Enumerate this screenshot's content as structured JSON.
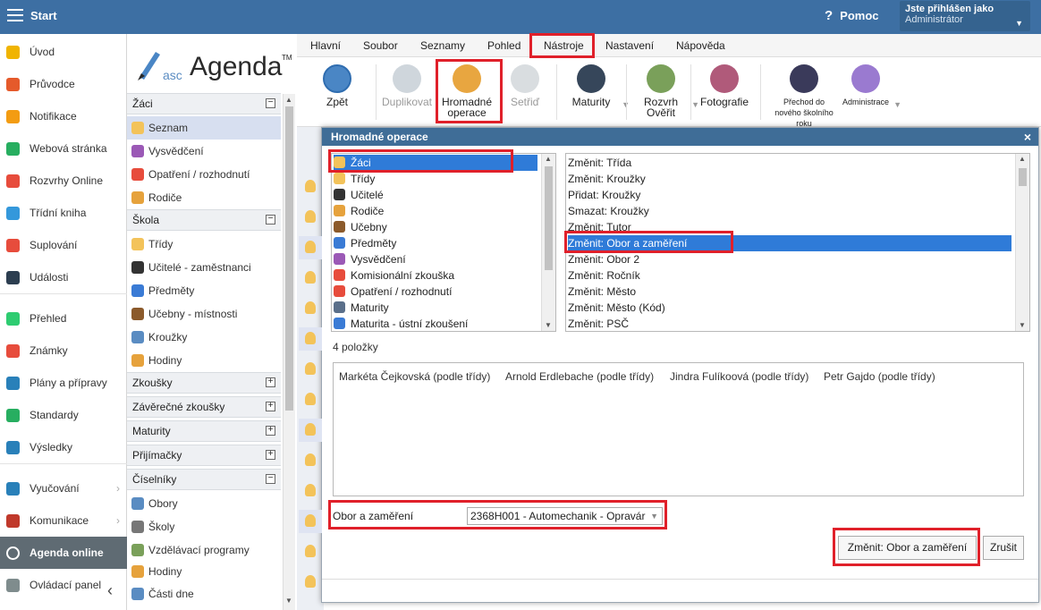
{
  "topbar": {
    "start_label": "Start",
    "help_label": "Pomoc",
    "help_icon": "?",
    "user_line1": "Jste přihlášen jako",
    "user_line2": "Administrátor"
  },
  "leftnav": {
    "items": [
      {
        "label": "Úvod",
        "icon": "star-icon",
        "color": "#f0b400"
      },
      {
        "label": "Průvodce",
        "icon": "wand-icon",
        "color": "#e55a2b"
      },
      {
        "label": "Notifikace",
        "icon": "envelope-icon",
        "color": "#f39c12"
      },
      {
        "label": "Webová stránka",
        "icon": "home-icon",
        "color": "#27ae60"
      },
      {
        "label": "Rozvrhy Online",
        "icon": "calendar-icon",
        "color": "#e74c3c"
      },
      {
        "label": "Třídní kniha",
        "icon": "book-icon",
        "color": "#3498db"
      },
      {
        "label": "Suplování",
        "icon": "substitute-icon",
        "color": "#e74c3c"
      },
      {
        "label": "Události",
        "icon": "events-icon",
        "color": "#2c3e50"
      },
      {
        "label": "Přehled",
        "icon": "check-icon",
        "color": "#2ecc71"
      },
      {
        "label": "Známky",
        "icon": "grades-icon",
        "color": "#e74c3c"
      },
      {
        "label": "Plány a přípravy",
        "icon": "briefcase-icon",
        "color": "#2980b9"
      },
      {
        "label": "Standardy",
        "icon": "shield-icon",
        "color": "#27ae60"
      },
      {
        "label": "Výsledky",
        "icon": "bar-chart-icon",
        "color": "#2980b9"
      },
      {
        "label": "Vyučování",
        "icon": "teaching-icon",
        "color": "#2980b9"
      },
      {
        "label": "Komunikace",
        "icon": "chat-icon",
        "color": "#c0392b"
      },
      {
        "label": "Agenda online",
        "icon": "agenda-icon",
        "color": "#ffffff"
      },
      {
        "label": "Ovládací panel",
        "icon": "gear-icon",
        "color": "#7f8c8d"
      }
    ]
  },
  "sidebar": {
    "logo_prefix": "asc",
    "logo_name": "Agenda",
    "logo_tm": "TM",
    "sections": [
      {
        "label": "Žáci",
        "toggle": "−",
        "items": [
          "Seznam",
          "Vysvědčení",
          "Opatření / rozhodnutí",
          "Rodiče"
        ]
      },
      {
        "label": "Škola",
        "toggle": "−",
        "items": [
          "Třídy",
          "Učitelé - zaměstnanci",
          "Předměty",
          "Učebny - místnosti",
          "Kroužky",
          "Hodiny"
        ]
      },
      {
        "label": "Zkoušky",
        "toggle": "+"
      },
      {
        "label": "Závěrečné zkoušky",
        "toggle": "+"
      },
      {
        "label": "Maturity",
        "toggle": "+"
      },
      {
        "label": "Přijímačky",
        "toggle": "+"
      },
      {
        "label": "Číselníky",
        "toggle": "−",
        "items": [
          "Obory",
          "Školy",
          "Vzdělávací programy",
          "Hodiny",
          "Části dne"
        ]
      }
    ]
  },
  "menubar": {
    "tabs": [
      "Hlavní",
      "Soubor",
      "Seznamy",
      "Pohled",
      "Nástroje",
      "Nastavení",
      "Nápověda"
    ],
    "active": "Nástroje"
  },
  "ribbon": {
    "buttons": [
      {
        "label": "Zpět",
        "icon": "back-arrow-icon"
      },
      {
        "label": "Duplikovat",
        "icon": "duplicate-icon"
      },
      {
        "label": "Hromadné operace",
        "icon": "group-icon"
      },
      {
        "label": "Setřiď",
        "icon": "sort-icon"
      },
      {
        "label": "Maturity",
        "icon": "graduation-cap-icon"
      },
      {
        "label": "Rozvrh Ověřit",
        "icon": "verify-icon"
      },
      {
        "label": "Fotografie",
        "icon": "photo-icon"
      },
      {
        "label": "Přechod do nového školního roku",
        "icon": "flag-icon"
      },
      {
        "label": "Administrace",
        "icon": "gears-icon"
      }
    ]
  },
  "dialog": {
    "title": "Hromadné operace",
    "close": "×",
    "entities": [
      {
        "label": "Žáci",
        "icon": "student-icon",
        "color": "#f3c35a"
      },
      {
        "label": "Třídy",
        "icon": "class-icon",
        "color": "#f3c35a"
      },
      {
        "label": "Učitelé",
        "icon": "teacher-icon",
        "color": "#333333"
      },
      {
        "label": "Rodiče",
        "icon": "parents-icon",
        "color": "#e6a23c"
      },
      {
        "label": "Učebny",
        "icon": "classroom-icon",
        "color": "#8b5a2b"
      },
      {
        "label": "Předměty",
        "icon": "subject-icon",
        "color": "#3a7bd5"
      },
      {
        "label": "Vysvědčení",
        "icon": "certificate-icon",
        "color": "#9b59b6"
      },
      {
        "label": "Komisionální zkouška",
        "icon": "exam-icon",
        "color": "#e74c3c"
      },
      {
        "label": "Opatření / rozhodnutí",
        "icon": "pin-icon",
        "color": "#e74c3c"
      },
      {
        "label": "Maturity",
        "icon": "graduation-cap-icon",
        "color": "#5a6f8a"
      },
      {
        "label": "Maturita - ústní zkoušení",
        "icon": "clock-icon",
        "color": "#3a7bd5"
      }
    ],
    "operations": [
      "Změnit: Třída",
      "Změnit: Kroužky",
      "Přidat: Kroužky",
      "Smazat: Kroužky",
      "Změnit: Tutor",
      "Změnit: Obor a zaměření",
      "Změnit: Obor 2",
      "Změnit: Ročník",
      "Změnit: Město",
      "Změnit: Město (Kód)",
      "Změnit: PSČ"
    ],
    "count_label": "4 položky",
    "students": [
      "Markéta Čejkovská (podle třídy)",
      "Arnold Erdlebache (podle třídy)",
      "Jindra Fulíkoová (podle třídy)",
      "Petr Gajdo (podle třídy)"
    ],
    "obor_label": "Obor a zaměření",
    "obor_value": "2368H001 - Automechanik - Opravár",
    "apply_label": "Změnit: Obor a zaměření",
    "cancel_label": "Zrušit"
  },
  "colors": {
    "topbar": "#3d6fa3",
    "dialog_title": "#3f6d97",
    "selection": "#2f7bd8",
    "highlight_box": "#e0202a"
  }
}
